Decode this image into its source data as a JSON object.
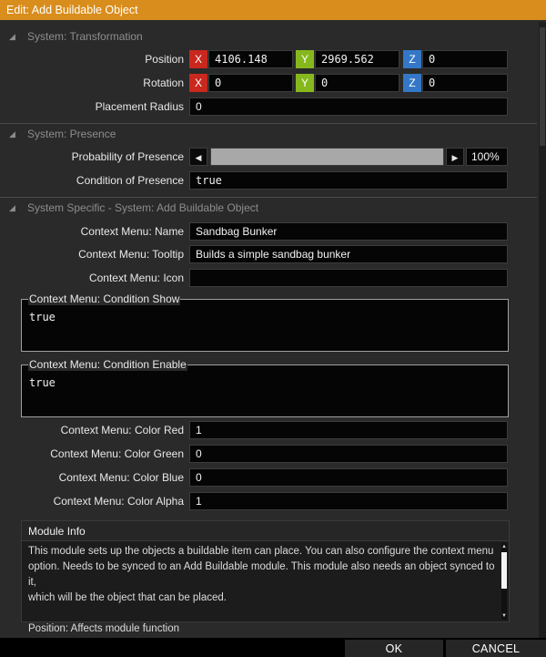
{
  "window": {
    "title": "Edit: Add Buildable Object"
  },
  "sections": {
    "transformation": {
      "title": "System: Transformation"
    },
    "presence": {
      "title": "System: Presence"
    },
    "specific": {
      "title": "System Specific - System: Add Buildable Object"
    }
  },
  "transformation": {
    "position": {
      "label": "Position",
      "x": "4106.148",
      "y": "2969.562",
      "z": "0"
    },
    "rotation": {
      "label": "Rotation",
      "x": "0",
      "y": "0",
      "z": "0"
    },
    "placement_radius": {
      "label": "Placement Radius",
      "value": "0"
    },
    "axis_labels": {
      "x": "X",
      "y": "Y",
      "z": "Z"
    }
  },
  "presence": {
    "probability": {
      "label": "Probability of Presence",
      "value_text": "100%",
      "value_fraction": 1.0
    },
    "condition": {
      "label": "Condition of Presence",
      "value": "true"
    }
  },
  "specific": {
    "name": {
      "label": "Context Menu: Name",
      "value": "Sandbag Bunker"
    },
    "tooltip": {
      "label": "Context Menu: Tooltip",
      "value": "Builds  a simple sandbag bunker"
    },
    "icon": {
      "label": "Context Menu: Icon",
      "value": ""
    },
    "condition_show": {
      "label": "Context Menu: Condition Show",
      "value": "true"
    },
    "condition_enable": {
      "label": "Context Menu: Condition Enable",
      "value": "true"
    },
    "color_red": {
      "label": "Context Menu: Color Red",
      "value": "1"
    },
    "color_green": {
      "label": "Context Menu: Color Green",
      "value": "0"
    },
    "color_blue": {
      "label": "Context Menu: Color Blue",
      "value": "0"
    },
    "color_alpha": {
      "label": "Context Menu: Color Alpha",
      "value": "1"
    }
  },
  "module_info": {
    "title": "Module Info",
    "line1": "This module sets up the objects a buildable item can place. You can also configure the context menu",
    "line2": "option. Needs to be synced to an Add Buildable module. This module also needs an object synced to it,",
    "line3": "which will be the object that can be placed.",
    "line4": "Position: Affects module function"
  },
  "buttons": {
    "ok": "OK",
    "cancel": "CANCEL"
  },
  "icons": {
    "collapse": "triangle-collapse-icon",
    "slider_left": "arrow-left-icon",
    "slider_right": "arrow-right-icon"
  },
  "colors": {
    "title_bar": "#d98d1c",
    "axis_x": "#c8281e",
    "axis_y": "#86b81e",
    "axis_z": "#3477c7"
  }
}
